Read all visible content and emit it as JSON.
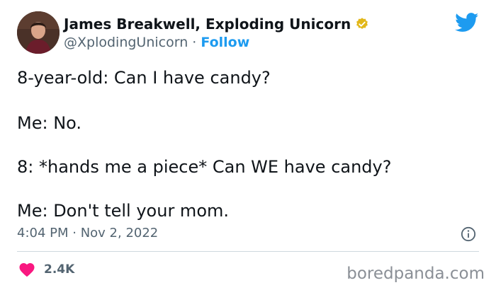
{
  "author": {
    "name": "James Breakwell, Exploding Unicorn",
    "handle": "@XplodingUnicorn",
    "separator": " · ",
    "follow_label": "Follow"
  },
  "tweet": {
    "lines": [
      "8-year-old: Can I have candy?",
      "Me: No.",
      "8: *hands me a piece* Can WE have candy?",
      "Me: Don't tell your mom."
    ],
    "timestamp": "4:04 PM · Nov 2, 2022",
    "like_count": "2.4K"
  },
  "watermark": "boredpanda.com",
  "icons": {
    "verified": "verified-badge-icon",
    "twitter": "twitter-bird-icon",
    "info": "info-icon",
    "like": "heart-icon"
  },
  "colors": {
    "twitter_blue": "#1d9bf0",
    "verified_gold": "#e2b719",
    "like_pink": "#f91880",
    "secondary_text": "#536471"
  }
}
